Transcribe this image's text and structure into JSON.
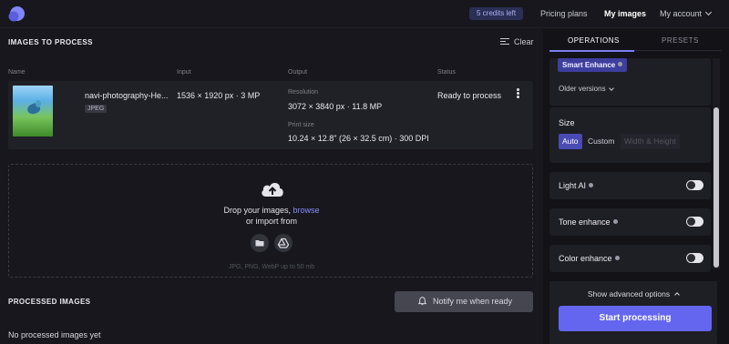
{
  "header": {
    "credits": "5 credits left",
    "nav": [
      "Pricing plans",
      "My images",
      "My account"
    ],
    "active_nav": "My images",
    "icons": {
      "logo": "app-logo",
      "account_menu": "chevron-down-icon"
    }
  },
  "images_to_process": {
    "title": "IMAGES TO PROCESS",
    "clear_label": "Clear",
    "columns": [
      "Name",
      "Input",
      "Output",
      "Status"
    ],
    "rows": [
      {
        "name": "navi-photography-He...",
        "type": "JPEG",
        "input": "1536 × 1920 px · 3 MP",
        "resolution_label": "Resolution",
        "resolution": "3072 × 3840 px · 11.8 MP",
        "print_label": "Print size",
        "print_size": "10.24 × 12.8\" (26 × 32.5 cm) · 300 DPI",
        "status": "Ready to process"
      }
    ]
  },
  "dropzone": {
    "text_prefix": "Drop your images,",
    "browse": "browse",
    "text_line2": "or import from",
    "formats": "JPG, PNG, WebP up to 50 mb",
    "icons": [
      "upload-cloud-icon",
      "folder-icon",
      "google-drive-icon"
    ]
  },
  "processed": {
    "title": "PROCESSED IMAGES",
    "notify_label": "Notify me when ready",
    "empty_text": "No processed images yet"
  },
  "sidebar": {
    "tabs": [
      "OPERATIONS",
      "PRESETS"
    ],
    "active_tab": "OPERATIONS",
    "enhance_label": "Smart Enhance",
    "older_versions": "Older versions",
    "size_label": "Size",
    "size_options": [
      "Auto",
      "Custom",
      "Width & Height"
    ],
    "size_selected": "Auto",
    "toggles": [
      {
        "label": "Light AI",
        "on": false
      },
      {
        "label": "Tone enhance",
        "on": false
      },
      {
        "label": "Color enhance",
        "on": false
      }
    ],
    "advanced_label": "Show advanced options",
    "start_label": "Start processing"
  },
  "colors": {
    "accent": "#6466f0",
    "background": "#17171d",
    "panel": "#1e1e25"
  }
}
